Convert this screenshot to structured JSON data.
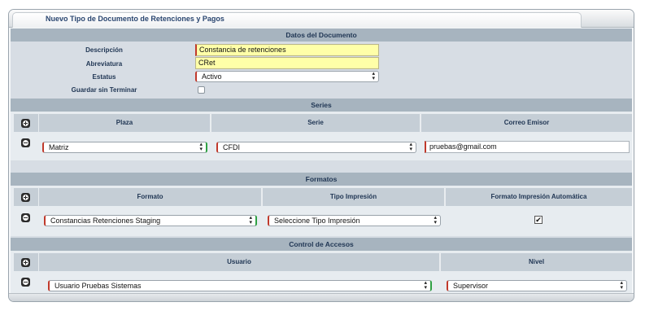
{
  "window": {
    "title": "Nuevo Tipo de Documento de Retenciones y Pagos"
  },
  "datos": {
    "header": "Datos del Documento",
    "descripcion_label": "Descripción",
    "descripcion_value": "Constancia de retenciones",
    "abreviatura_label": "Abreviatura",
    "abreviatura_value": "CRet",
    "estatus_label": "Estatus",
    "estatus_value": "Activo",
    "guardar_label": "Guardar sin Terminar",
    "guardar_checked": false
  },
  "series": {
    "header": "Series",
    "columns": [
      "Plaza",
      "Serie",
      "Correo Emisor"
    ],
    "row": {
      "plaza": "Matriz",
      "serie": "CFDI",
      "correo": "pruebas@gmail.com"
    }
  },
  "formatos": {
    "header": "Formatos",
    "columns": [
      "Formato",
      "Tipo Impresión",
      "Formato Impresión Automática"
    ],
    "row": {
      "formato": "Constancias Retenciones Staging",
      "tipo": "Seleccione Tipo Impresión",
      "automatica": true,
      "check_glyph": "✔"
    }
  },
  "accesos": {
    "header": "Control de Accesos",
    "columns": [
      "Usuario",
      "Nivel"
    ],
    "row": {
      "usuario": "Usuario Pruebas Sistemas",
      "nivel": "Supervisor"
    }
  },
  "icons": {
    "add": "plus-circle-icon",
    "remove": "minus-circle-icon",
    "select": "updown-arrows-icon"
  },
  "colors": {
    "input_bg": "#ffffa8",
    "section_header": "#a7b4bf",
    "required_marker": "#c0392b",
    "valid_marker": "#2ea043"
  }
}
